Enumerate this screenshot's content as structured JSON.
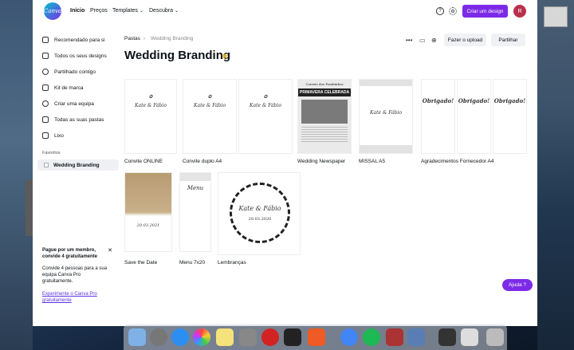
{
  "topbar": {
    "logo_text": "Canva",
    "nav": [
      "Início",
      "Preços",
      "Templates",
      "Descubra"
    ],
    "create_label": "Criar um design",
    "avatar_initial": "R"
  },
  "sidebar": {
    "items": [
      "Recomendado para si",
      "Todos os seus designs",
      "Partilhado contigo",
      "Kit de marca",
      "Criar uma equipa",
      "Todas as suas pastas",
      "Lixo"
    ],
    "favorites_heading": "Favoritos",
    "favorite_selected": "Wedding Branding"
  },
  "promo": {
    "title": "Pague por um membro, convide 4 gratuitamente",
    "body": "Convide 4 pessoas para a sua equipa Canva Pro gratuitamente.",
    "link": "Experimente o Canva Pro gratuitamente"
  },
  "main": {
    "breadcrumb_root": "Pastas",
    "breadcrumb_current": "Wedding Branding",
    "title": "Wedding Branding",
    "upload_label": "Fazer o upload",
    "share_label": "Partilhar"
  },
  "designs": [
    {
      "label": "Convite ONLINE",
      "names": "Kate & Fábio"
    },
    {
      "label": "Convite duplo A4",
      "names": "Kate & Fábio"
    },
    {
      "label": "Wedding Newspaper",
      "headline": "PRIMAVERA CELEBRADA",
      "masthead": "Correio dos Pombinhos"
    },
    {
      "label": "MISSAL A5",
      "names": "Kate & Fábio"
    },
    {
      "label": "Agradecimentos Fornecedor A4",
      "thanks": "Obrigado!"
    },
    {
      "label": "Save the Date",
      "date": "20.03.2021"
    },
    {
      "label": "Menu 7x20",
      "menu_title": "Menu"
    },
    {
      "label": "Lembranças",
      "names": "Kate & Fábio",
      "date": "20.03.2020"
    }
  ],
  "help_label": "Ajuda ?",
  "colors": {
    "brand": "#7d2ae8",
    "avatar": "#b9304c",
    "star": "#d9b21d"
  }
}
